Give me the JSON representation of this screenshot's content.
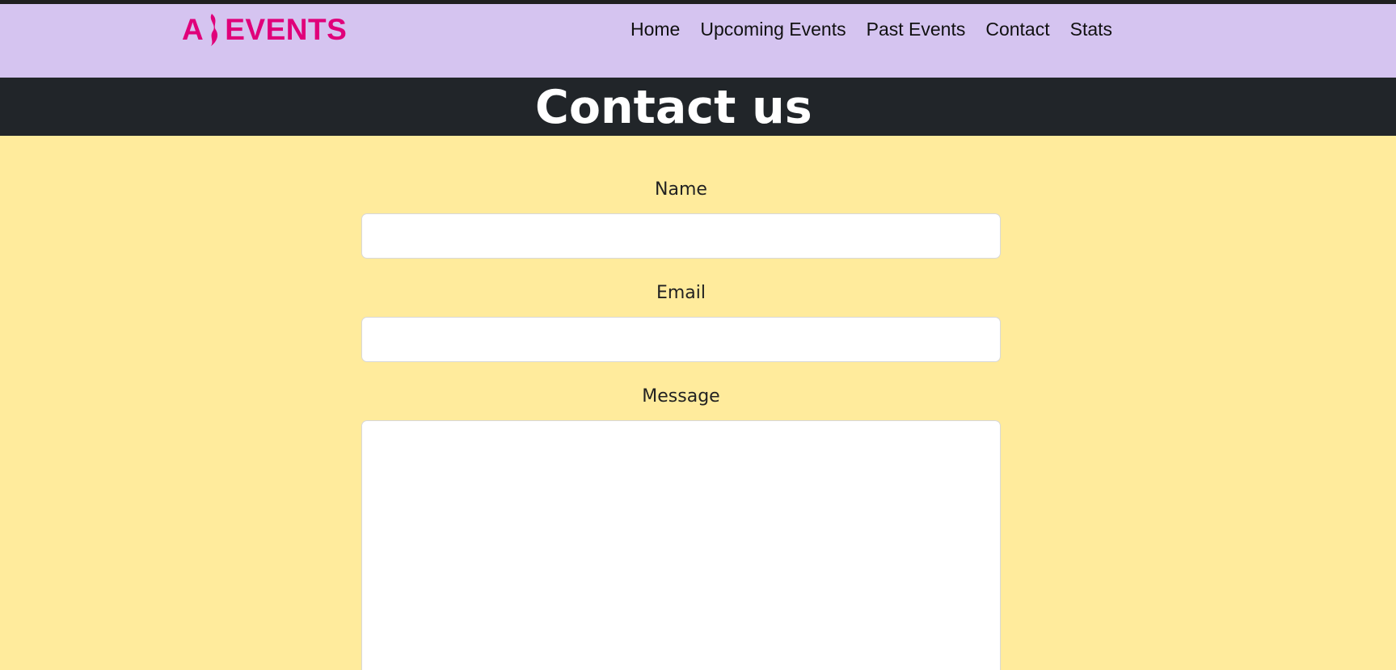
{
  "brand": {
    "logo_text_left": "A",
    "logo_text_right": "EVENTS",
    "logo_color": "#e0007a"
  },
  "nav": {
    "items": [
      {
        "label": "Home"
      },
      {
        "label": "Upcoming Events"
      },
      {
        "label": "Past Events"
      },
      {
        "label": "Contact"
      },
      {
        "label": "Stats"
      }
    ]
  },
  "hero": {
    "title": "Contact us"
  },
  "form": {
    "name_label": "Name",
    "name_value": "",
    "email_label": "Email",
    "email_value": "",
    "message_label": "Message",
    "message_value": ""
  },
  "colors": {
    "navbar_bg": "#d5c4f0",
    "hero_bg": "#212529",
    "page_bg": "#ffeb9c"
  }
}
